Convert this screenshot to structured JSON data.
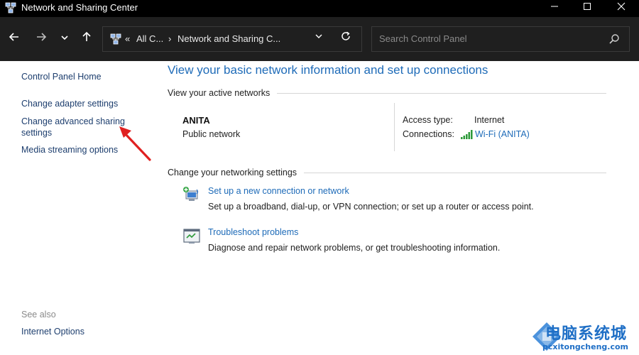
{
  "window": {
    "title": "Network and Sharing Center"
  },
  "address_bar": {
    "crumb_overflow": "«",
    "crumb_1": "All C...",
    "crumb_sep": "›",
    "crumb_2": "Network and Sharing C..."
  },
  "search": {
    "placeholder": "Search Control Panel"
  },
  "sidebar": {
    "items": [
      {
        "label": "Control Panel Home"
      },
      {
        "label": "Change adapter settings"
      },
      {
        "label": "Change advanced sharing"
      },
      {
        "label": "settings"
      },
      {
        "label": "Media streaming options"
      }
    ],
    "see_also_label": "See also",
    "see_also_items": [
      {
        "label": "Internet Options"
      }
    ]
  },
  "main": {
    "heading": "View your basic network information and set up connections",
    "active_networks_label": "View your active networks",
    "network": {
      "name": "ANITA",
      "type": "Public network",
      "access_type_label": "Access type:",
      "access_type_value": "Internet",
      "connections_label": "Connections:",
      "connection_link": "Wi-Fi (ANITA)"
    },
    "change_settings_label": "Change your networking settings",
    "tasks": [
      {
        "link": "Set up a new connection or network",
        "desc": "Set up a broadband, dial-up, or VPN connection; or set up a router or access point.",
        "icon": "new-connection-icon"
      },
      {
        "link": "Troubleshoot problems",
        "desc": "Diagnose and repair network problems, or get troubleshooting information.",
        "icon": "troubleshoot-icon"
      }
    ]
  },
  "watermark": {
    "text": "电脑系统城",
    "url": "pcxitongcheng.com"
  },
  "colors": {
    "link": "#1e6bb8",
    "sidebar_link": "#1d3e6e",
    "titlebar": "#000000",
    "toolbar": "#1f1f1f",
    "annotation_arrow": "#e02020"
  }
}
